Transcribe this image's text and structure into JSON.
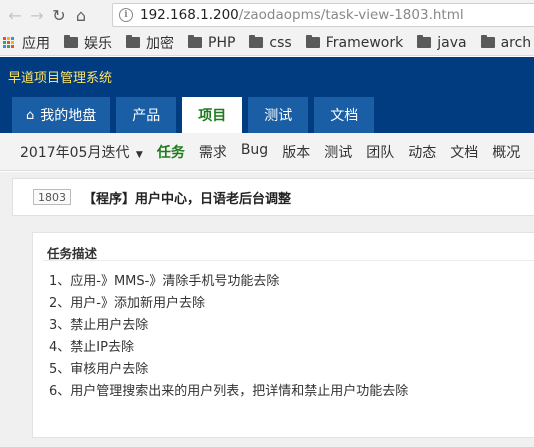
{
  "browser": {
    "url_host": "192.168.1.200",
    "url_path": "/zaodaopms/task-view-1803.html",
    "bookmarks": [
      {
        "label": "应用",
        "icon": "apps-icon"
      },
      {
        "label": "娱乐",
        "icon": "folder-icon"
      },
      {
        "label": "加密",
        "icon": "folder-icon"
      },
      {
        "label": "PHP",
        "icon": "folder-icon"
      },
      {
        "label": "css",
        "icon": "folder-icon"
      },
      {
        "label": "Framework",
        "icon": "folder-icon"
      },
      {
        "label": "java",
        "icon": "folder-icon"
      },
      {
        "label": "arch",
        "icon": "folder-icon"
      }
    ]
  },
  "app": {
    "title": "早道项目管理系统",
    "tabs": [
      {
        "label": "我的地盘",
        "icon": "home-icon",
        "active": false
      },
      {
        "label": "产品",
        "active": false
      },
      {
        "label": "项目",
        "active": true
      },
      {
        "label": "测试",
        "active": false
      },
      {
        "label": "文档",
        "active": false
      }
    ]
  },
  "subnav": {
    "iteration": "2017年05月迭代",
    "items": [
      {
        "label": "任务",
        "active": true
      },
      {
        "label": "需求",
        "active": false
      },
      {
        "label": "Bug",
        "active": false
      },
      {
        "label": "版本",
        "active": false
      },
      {
        "label": "测试",
        "active": false
      },
      {
        "label": "团队",
        "active": false
      },
      {
        "label": "动态",
        "active": false
      },
      {
        "label": "文档",
        "active": false
      },
      {
        "label": "概况",
        "active": false
      }
    ]
  },
  "task": {
    "id": "1803",
    "name": "【程序】用户中心，日语老后台调整",
    "desc_title": "任务描述",
    "desc_items": [
      "1、应用-》MMS-》清除手机号功能去除",
      "2、用户-》添加新用户去除",
      "3、禁止用户去除",
      "4、禁止IP去除",
      "5、审核用户去除",
      "6、用户管理搜索出来的用户列表，把详情和禁止用户功能去除"
    ]
  },
  "colors": {
    "header_bg": "#003c7f",
    "title_yellow": "#fde26a",
    "tab_bg": "#1a5fa6",
    "active_green": "#1e7a1e"
  }
}
